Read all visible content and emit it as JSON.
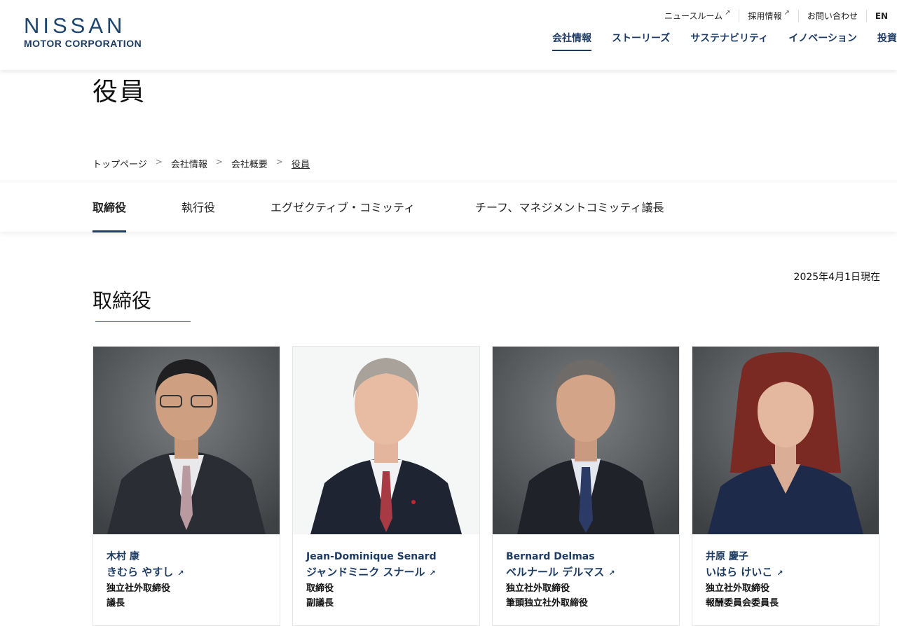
{
  "header": {
    "logo_main": "NISSAN",
    "logo_sub": "MOTOR CORPORATION",
    "util_links": [
      "ニュースルーム",
      "採用情報",
      "お問い合わせ",
      "EN"
    ],
    "nav": [
      "会社情報",
      "ストーリーズ",
      "サステナビリティ",
      "イノベーション",
      "投資家"
    ]
  },
  "page": {
    "title": "役員"
  },
  "breadcrumb": [
    "トップページ",
    "会社情報",
    "会社概要",
    "役員"
  ],
  "tabs": [
    "取締役",
    "執行役",
    "エグゼクティブ・コミッティ",
    "チーフ、マネジメントコミッティ議長"
  ],
  "section": {
    "date": "2025年4月1日現在",
    "title": "取締役"
  },
  "cards": [
    {
      "name1": "木村 康",
      "name2": "きむら やすし",
      "role1": "独立社外取締役",
      "role2": "議長"
    },
    {
      "name1": "Jean-Dominique Senard",
      "name2": "ジャンドミニク スナール",
      "role1": "取締役",
      "role2": "副議長"
    },
    {
      "name1": "Bernard Delmas",
      "name2": "ベルナール デルマス",
      "role1": "独立社外取締役",
      "role2": "筆頭独立社外取締役"
    },
    {
      "name1": "井原 慶子",
      "name2": "いはら けいこ",
      "role1": "独立社外取締役",
      "role2": "報酬委員会委員長"
    }
  ],
  "icons": {
    "external_link": "↗"
  },
  "colors": {
    "brand": "#1d3b63",
    "photo_bg_gray": "#5d6063",
    "photo_bg_white": "#f5f6f6"
  }
}
